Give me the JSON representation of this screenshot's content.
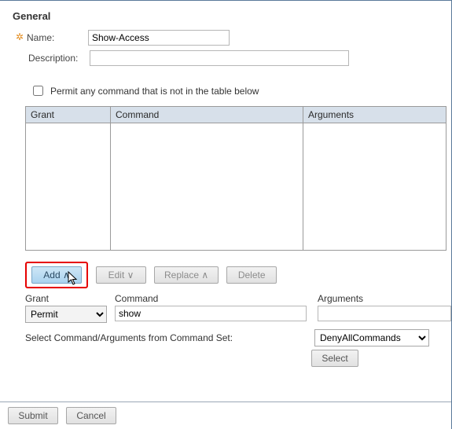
{
  "section": {
    "title": "General"
  },
  "form": {
    "name_label": "Name:",
    "name_value": "Show-Access",
    "desc_label": "Description:",
    "desc_value": ""
  },
  "permit": {
    "label": "Permit any command that is not in the table below",
    "checked": false
  },
  "table": {
    "headers": {
      "grant": "Grant",
      "command": "Command",
      "arguments": "Arguments"
    }
  },
  "toolbar": {
    "add": "Add ∧",
    "edit": "Edit ∨",
    "replace": "Replace ∧",
    "delete": "Delete"
  },
  "entry": {
    "grant_label": "Grant",
    "command_label": "Command",
    "arguments_label": "Arguments",
    "grant_value": "Permit",
    "command_value": "show",
    "arguments_value": ""
  },
  "cmdset": {
    "label": "Select Command/Arguments from Command Set:",
    "value": "DenyAllCommands",
    "select_btn": "Select"
  },
  "footer": {
    "submit": "Submit",
    "cancel": "Cancel"
  }
}
